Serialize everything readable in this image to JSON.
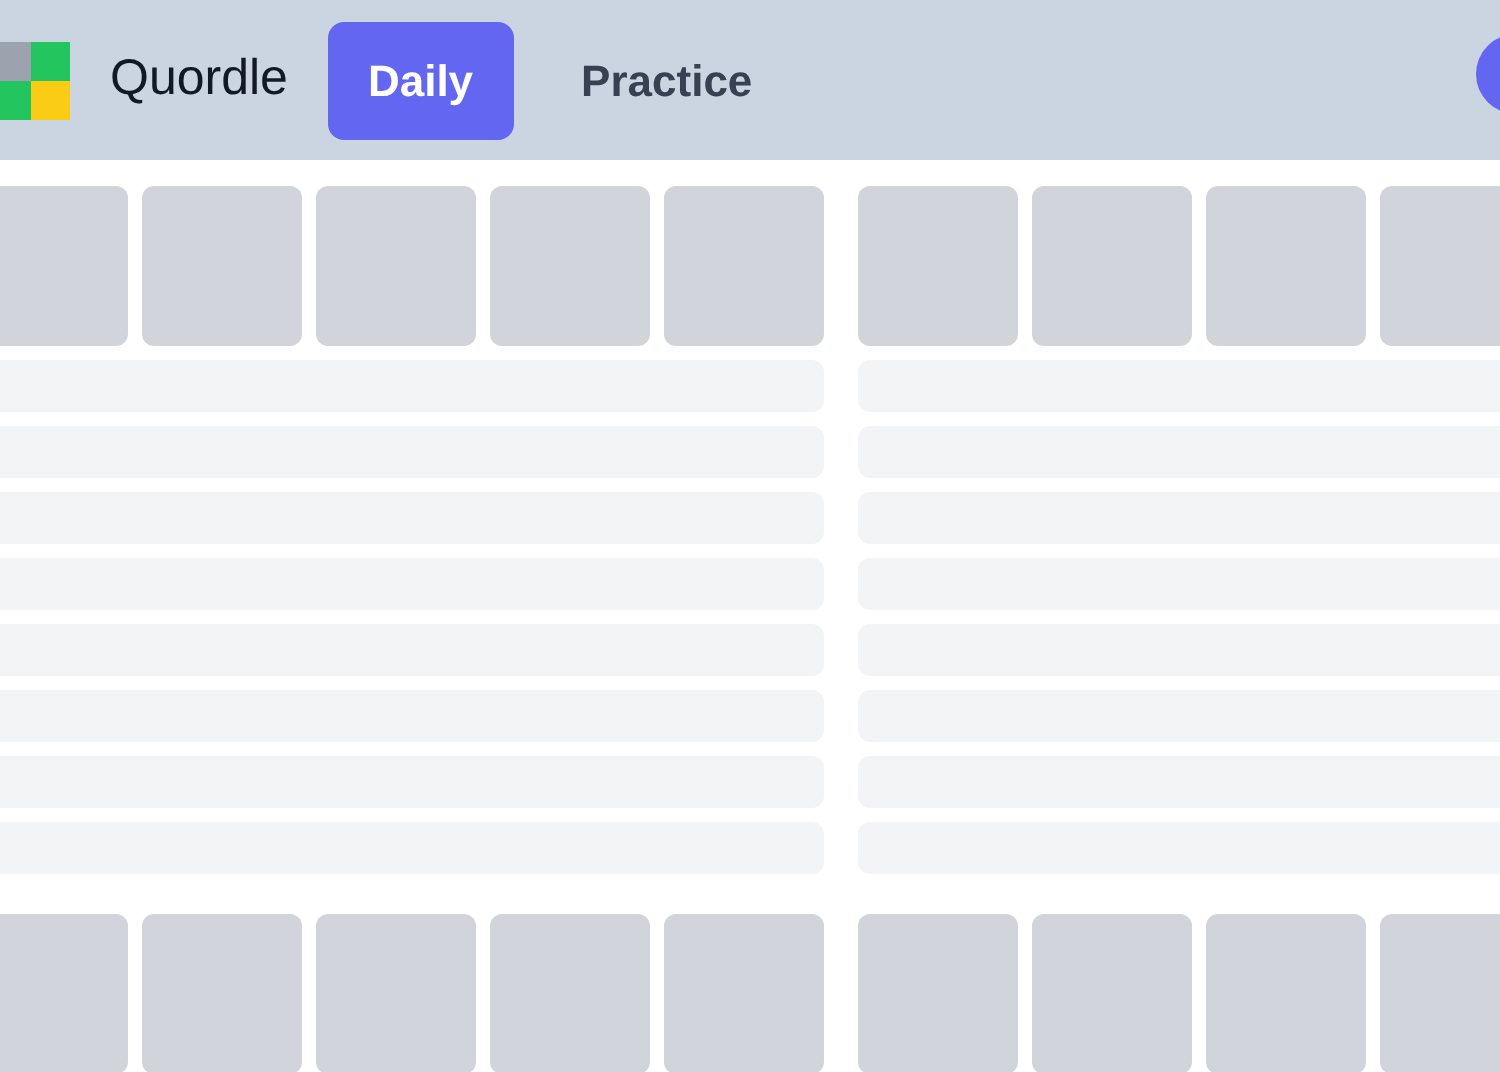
{
  "header": {
    "title": "Quordle"
  },
  "tabs": [
    {
      "label": "Daily",
      "selected": true
    },
    {
      "label": "Practice",
      "selected": false
    }
  ]
}
